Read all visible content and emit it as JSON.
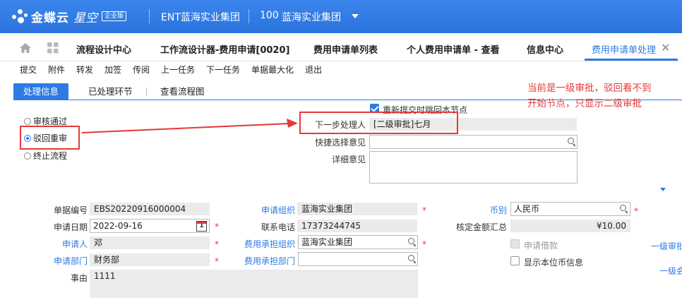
{
  "header": {
    "logo_text": "金蝶云",
    "logo_product": "星空",
    "logo_badge": "企业版",
    "org_name": "ENT蓝海实业集团",
    "org_code": "100",
    "org_unit": "蓝海实业集团"
  },
  "tabs": {
    "items": [
      {
        "label": "流程设计中心"
      },
      {
        "label": "工作流设计器-费用申请[0020]"
      },
      {
        "label": "费用申请单列表"
      },
      {
        "label": "个人费用申请单 - 查看"
      },
      {
        "label": "信息中心"
      },
      {
        "label": "费用申请单处理"
      }
    ]
  },
  "toolbar": {
    "items": [
      "提交",
      "附件",
      "转发",
      "加签",
      "传阅",
      "上一任务",
      "下一任务",
      "单据最大化",
      "退出"
    ]
  },
  "subtabs": {
    "items": [
      "处理信息",
      "已处理环节",
      "查看流程图"
    ]
  },
  "process": {
    "options": [
      "审核通过",
      "驳回重审",
      "终止流程"
    ],
    "selected": "驳回重审",
    "resubmit_label": "重新提交时跳回本节点",
    "resubmit_checked": true,
    "next_handler_label": "下一步处理人",
    "next_handler_value": "[二级审批]七月",
    "quick_opinion_label": "快捷选择意见",
    "quick_opinion_value": "",
    "detail_opinion_label": "详细意见",
    "detail_opinion_value": ""
  },
  "annotation": {
    "line1": "当前是一级审批，驳回看不到",
    "line2": "开始节点，只显示二级审批"
  },
  "form": {
    "bill_no_label": "单据编号",
    "bill_no": "EBS20220916000004",
    "apply_date_label": "申请日期",
    "apply_date": "2022-09-16",
    "applicant_label": "申请人",
    "applicant": "邓",
    "dept_label": "申请部门",
    "dept": "财务部",
    "reason_label": "事由",
    "reason": "1111",
    "apply_org_label": "申请组织",
    "apply_org": "蓝海实业集团",
    "phone_label": "联系电话",
    "phone": "17373244745",
    "cost_org_label": "费用承担组织",
    "cost_org": "蓝海实业集团",
    "cost_dept_label": "费用承担部门",
    "cost_dept": "",
    "currency_label": "币别",
    "currency": "人民币",
    "total_label": "核定金额汇总",
    "total": "¥10.00",
    "loan_label": "申请借款",
    "show_local_label": "显示本位币信息",
    "right_text1": "一级审批",
    "right_text2": "一级会"
  },
  "colors": {
    "brand": "#2c7be5",
    "annotation": "#e53935"
  }
}
